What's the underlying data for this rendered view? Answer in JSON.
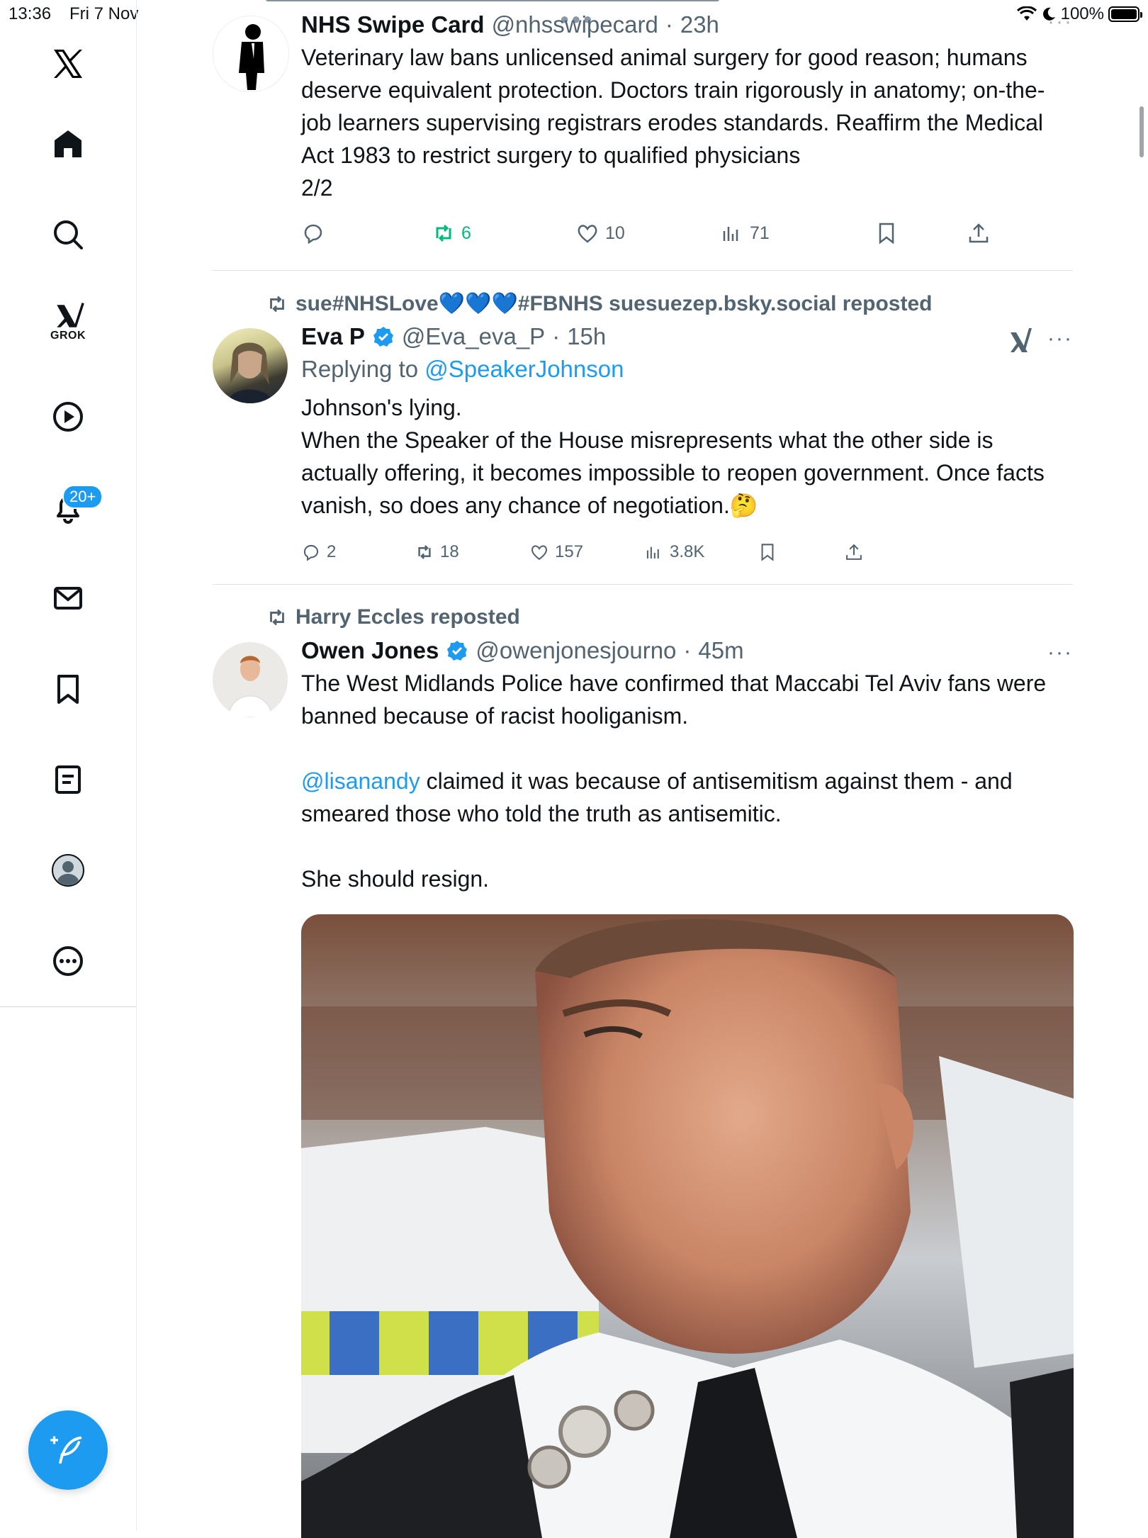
{
  "status": {
    "time": "13:36",
    "date": "Fri 7 Nov",
    "battery": "100%",
    "battery_level": 1.0
  },
  "sidebar": {
    "items": [
      {
        "icon": "x-logo-icon"
      },
      {
        "icon": "home-icon"
      },
      {
        "icon": "search-icon"
      },
      {
        "icon": "grok-icon",
        "label": "GROK"
      },
      {
        "icon": "video-icon"
      },
      {
        "icon": "notifications-icon",
        "badge": "20+"
      },
      {
        "icon": "messages-icon"
      },
      {
        "icon": "bookmarks-icon"
      },
      {
        "icon": "lists-icon"
      },
      {
        "icon": "profile-icon"
      },
      {
        "icon": "more-icon"
      }
    ]
  },
  "tweets": [
    {
      "name": "NHS Swipe Card",
      "handle": "@nhsswipecard",
      "time": "23h",
      "text": "Veterinary law bans unlicensed animal surgery for good reason; humans deserve equivalent protection. Doctors train rigorously in anatomy; on-the-job learners supervising registrars erodes standards. Reaffirm the Medical Act 1983 to restrict surgery to qualified physicians\n2/2",
      "reposts": "6",
      "likes": "10",
      "views": "71"
    },
    {
      "reposted_by": "sue#NHSLove💙💙💙#FBNHS suesuezep.bsky.social reposted",
      "name": "Eva P",
      "handle": "@Eva_eva_P",
      "time": "15h",
      "replying_prefix": "Replying to",
      "replying_to": "@SpeakerJohnson",
      "text": "Johnson's lying.\nWhen the Speaker of the House misrepresents what the other side is actually offering, it becomes impossible to reopen government. Once facts vanish, so does any chance of negotiation.🤔",
      "replies": "2",
      "reposts": "18",
      "likes": "157",
      "views": "3.8K"
    },
    {
      "reposted_by": "Harry Eccles reposted",
      "name": "Owen Jones",
      "handle": "@owenjonesjourno",
      "time": "45m",
      "text_1": "The West Midlands Police have confirmed that Maccabi Tel Aviv fans were banned because of racist hooliganism.",
      "mention": "@lisanandy",
      "text_2": " claimed it was because of antisemitism against them - and smeared those who told the truth as antisemitic.",
      "text_3": "She should resign."
    }
  ],
  "colors": {
    "accent": "#1d9bf0",
    "repost_active": "#00ba7c",
    "muted": "#536471"
  }
}
